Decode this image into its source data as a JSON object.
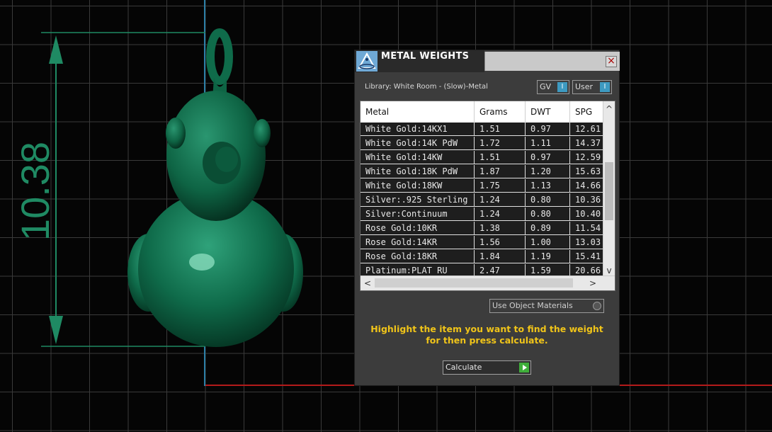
{
  "viewport": {
    "dimension_value": "10.38",
    "colors": {
      "model": "#0f6b4a",
      "dimension": "#1f8a63",
      "axis_x": "#b31a1a",
      "axis_y": "#2b7fa6",
      "grid": "#3a3a3a"
    }
  },
  "dialog": {
    "title": "METAL WEIGHTS",
    "close_label": "×",
    "library_label": "Library: White Room - (Slow)-Metal",
    "gv_toggle": {
      "label": "GV",
      "indicator": "I"
    },
    "user_toggle": {
      "label": "User",
      "indicator": "I"
    },
    "table": {
      "columns": [
        "Metal",
        "Grams",
        "DWT",
        "SPG"
      ],
      "rows": [
        [
          "White Gold:14KX1",
          "1.51",
          "0.97",
          "12.61"
        ],
        [
          "White Gold:14K PdW",
          "1.72",
          "1.11",
          "14.37"
        ],
        [
          "White Gold:14KW",
          "1.51",
          "0.97",
          "12.59"
        ],
        [
          "White Gold:18K PdW",
          "1.87",
          "1.20",
          "15.63"
        ],
        [
          "White Gold:18KW",
          "1.75",
          "1.13",
          "14.66"
        ],
        [
          "Silver:.925 Sterling",
          "1.24",
          "0.80",
          "10.36"
        ],
        [
          "Silver:Continuum",
          "1.24",
          "0.80",
          "10.40"
        ],
        [
          "Rose Gold:10KR",
          "1.38",
          "0.89",
          "11.54"
        ],
        [
          "Rose Gold:14KR",
          "1.56",
          "1.00",
          "13.03"
        ],
        [
          "Rose Gold:18KR",
          "1.84",
          "1.19",
          "15.41"
        ],
        [
          "Platinum:PLAT RU",
          "2.47",
          "1.59",
          "20.66"
        ]
      ],
      "scroll_up": "^",
      "scroll_down": "v",
      "scroll_left": "<",
      "scroll_right": ">"
    },
    "use_object_materials_label": "Use Object Materials",
    "instructions_line1": "Highlight the item you want to find the weight",
    "instructions_line2": "for then press calculate.",
    "calculate_label": "Calculate"
  }
}
